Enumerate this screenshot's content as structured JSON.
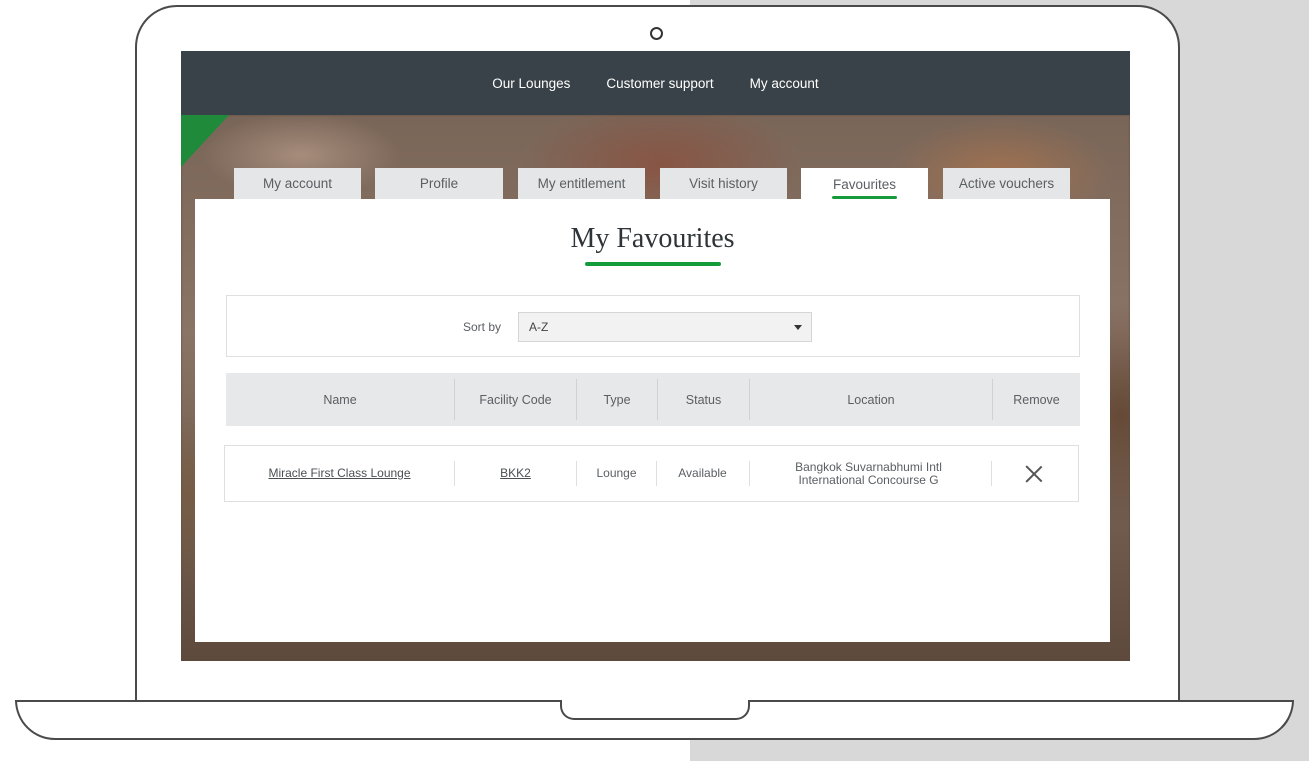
{
  "nav": {
    "items": [
      "Our Lounges",
      "Customer support",
      "My account"
    ]
  },
  "tabs": [
    {
      "label": "My account",
      "active": false
    },
    {
      "label": "Profile",
      "active": false
    },
    {
      "label": "My entitlement",
      "active": false
    },
    {
      "label": "Visit history",
      "active": false
    },
    {
      "label": "Favourites",
      "active": true
    },
    {
      "label": "Active vouchers",
      "active": false
    }
  ],
  "page": {
    "title": "My Favourites"
  },
  "sort": {
    "label": "Sort by",
    "selected": "A-Z"
  },
  "table": {
    "columns": [
      "Name",
      "Facility Code",
      "Type",
      "Status",
      "Location",
      "Remove"
    ],
    "rows": [
      {
        "name": "Miracle First Class Lounge",
        "facility_code": "BKK2",
        "type": "Lounge",
        "status": "Available",
        "location_line1": "Bangkok Suvarnabhumi Intl",
        "location_line2": "International Concourse G"
      }
    ]
  },
  "colors": {
    "accent": "#159a3c",
    "topbar": "#394248",
    "tab_bg": "#e5e6e7"
  },
  "icons": {
    "remove": "close-icon",
    "select": "caret-down-icon"
  }
}
